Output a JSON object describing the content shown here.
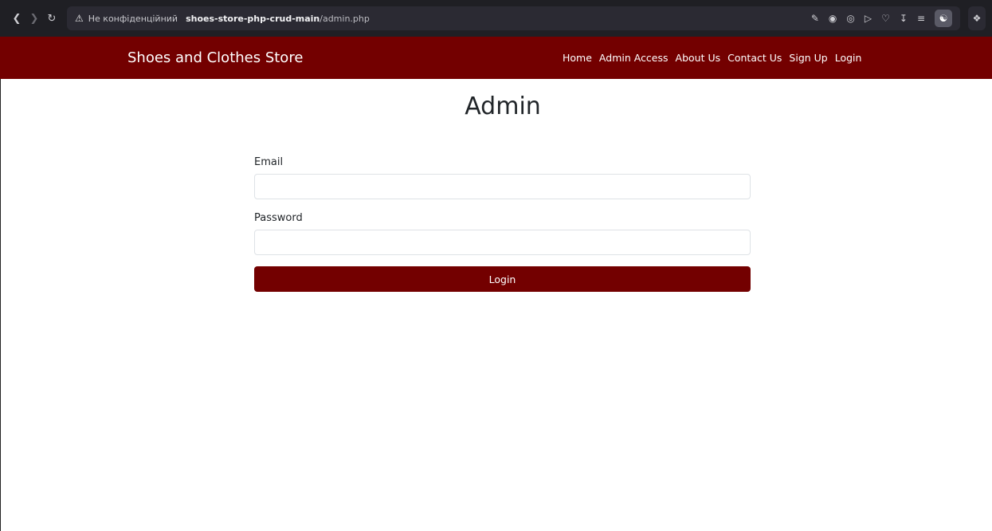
{
  "browser": {
    "back_icon": "chevron-left-icon",
    "forward_icon": "chevron-right-icon",
    "reload_icon": "reload-icon",
    "security_warning": "Не конфіденційний",
    "url_host": "shoes-store-php-crud-main",
    "url_path": "/admin.php"
  },
  "navbar": {
    "brand": "Shoes and Clothes Store",
    "links": [
      "Home",
      "Admin Access",
      "About Us",
      "Contact Us",
      "Sign Up",
      "Login"
    ],
    "background": "#730000"
  },
  "page": {
    "title": "Admin"
  },
  "form": {
    "email_label": "Email",
    "email_value": "",
    "password_label": "Password",
    "password_value": "",
    "submit_label": "Login"
  },
  "colors": {
    "accent": "#730000",
    "chrome": "#1f1f24"
  }
}
